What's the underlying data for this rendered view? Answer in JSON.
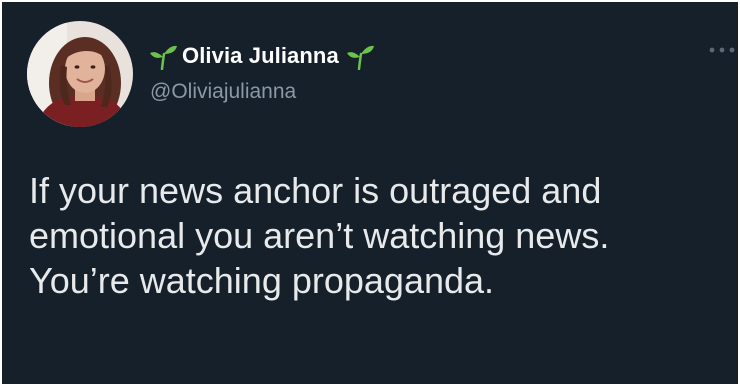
{
  "tweet": {
    "author": {
      "display_name": "Olivia Julianna",
      "handle": "@Oliviajulianna",
      "name_emoji_icon": "sprout-icon"
    },
    "more_icon": "more-options-icon",
    "text": "If your news anchor is outraged and\nemotional you aren’t watching news.\nYou’re watching propaganda."
  },
  "colors": {
    "background": "#15202b",
    "primary_text": "#e7e9ea",
    "secondary_text": "#8b98a5",
    "sprout_green": "#6cc24a"
  }
}
